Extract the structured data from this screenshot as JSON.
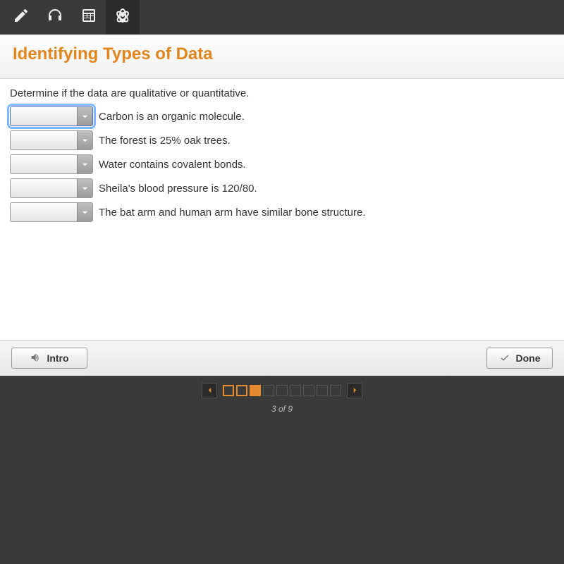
{
  "toolbar": {
    "icons": [
      "pencil",
      "headphones",
      "calculator",
      "atom"
    ],
    "selected_index": 3
  },
  "header": {
    "title": "Identifying Types of Data"
  },
  "instruction": "Determine if the data are qualitative or quantitative.",
  "questions": [
    {
      "text": "Carbon is an organic molecule.",
      "value": "",
      "focused": true
    },
    {
      "text": "The forest is 25% oak trees.",
      "value": "",
      "focused": false
    },
    {
      "text": "Water contains covalent bonds.",
      "value": "",
      "focused": false
    },
    {
      "text": "Sheila's blood pressure is 120/80.",
      "value": "",
      "focused": false
    },
    {
      "text": "The bat arm and human arm have similar bone structure.",
      "value": "",
      "focused": false
    }
  ],
  "buttons": {
    "intro": "Intro",
    "done": "Done"
  },
  "pager": {
    "total": 9,
    "current": 3,
    "label": "3 of 9",
    "states": [
      "done",
      "done",
      "current",
      "future",
      "future",
      "future",
      "future",
      "future",
      "future"
    ]
  }
}
